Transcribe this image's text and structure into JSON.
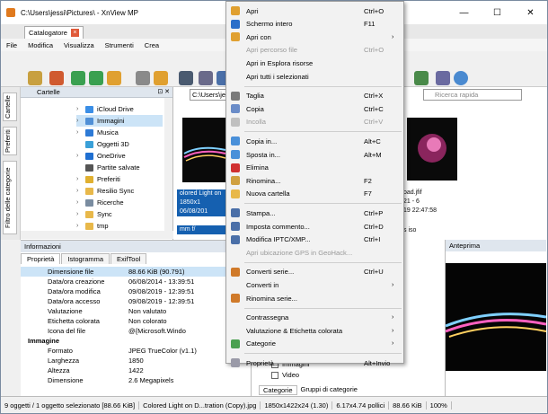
{
  "window": {
    "title": "C:\\Users\\jessi\\Pictures\\ - XnView MP",
    "min": "—",
    "max": "☐",
    "close": "✕"
  },
  "tab": {
    "label": "Catalogatore",
    "close": "×"
  },
  "menubar": [
    "File",
    "Modifica",
    "Visualizza",
    "Strumenti",
    "Crea"
  ],
  "sidebar_tabs": [
    "Cartelle",
    "Preferiti",
    "Filtro delle categorie"
  ],
  "folders": {
    "title": "Cartelle",
    "items": [
      {
        "label": "iCloud Drive",
        "expandable": true,
        "color": "#3a8ee6"
      },
      {
        "label": "Immagini",
        "expandable": true,
        "color": "#4f8fd6",
        "selected": true
      },
      {
        "label": "Musica",
        "expandable": true,
        "color": "#2d7ad6"
      },
      {
        "label": "Oggetti 3D",
        "expandable": false,
        "color": "#3aa0d8"
      },
      {
        "label": "OneDrive",
        "expandable": true,
        "color": "#1f6fd1"
      },
      {
        "label": "Partite salvate",
        "expandable": false,
        "color": "#555555"
      },
      {
        "label": "Preferiti",
        "expandable": true,
        "color": "#e0b030"
      },
      {
        "label": "Resilio Sync",
        "expandable": true,
        "color": "#e8b84a"
      },
      {
        "label": "Ricerche",
        "expandable": true,
        "color": "#7a8ca0"
      },
      {
        "label": "Sync",
        "expandable": true,
        "color": "#e8b84a"
      },
      {
        "label": "tmp",
        "expandable": true,
        "color": "#e8b84a"
      }
    ]
  },
  "browser": {
    "address": "C:\\Users\\je",
    "search_placeholder": "Ricerca rapida",
    "thumb1_lines": [
      "olored Light on",
      "1850x1",
      "06/08/201",
      "mm f/"
    ],
    "thumb2_lines": [
      "oad.jfif",
      "21 - 6",
      "19 22:47:58",
      "s iso"
    ]
  },
  "info": {
    "title": "Informazioni",
    "tabs": [
      "Proprietà",
      "Istogramma",
      "ExifTool"
    ],
    "rows": [
      {
        "k": "Dimensione file",
        "v": "88.66 KiB (90.791)",
        "sel": true
      },
      {
        "k": "Data/ora creazione",
        "v": "06/08/2014 - 13:39:51"
      },
      {
        "k": "Data/ora modifica",
        "v": "09/08/2019 - 12:39:51"
      },
      {
        "k": "Data/ora accesso",
        "v": "09/08/2019 - 12:39:51"
      },
      {
        "k": "Valutazione",
        "v": "Non valutato"
      },
      {
        "k": "Etichetta colorata",
        "v": "Non colorato"
      },
      {
        "k": "Icona del file",
        "v": "@{Microsoft.Windo"
      },
      {
        "k": "Immagine",
        "v": "",
        "group": true
      },
      {
        "k": "Formato",
        "v": "JPEG TrueColor (v1.1)"
      },
      {
        "k": "Larghezza",
        "v": "1850"
      },
      {
        "k": "Altezza",
        "v": "1422"
      },
      {
        "k": "Dimensione",
        "v": "2.6 Megapixels"
      }
    ]
  },
  "categories": {
    "items": [
      "Immagini",
      "Video"
    ],
    "tabs": [
      "Categorie",
      "Gruppi di categorie"
    ]
  },
  "preview": {
    "title": "Anteprima"
  },
  "status": [
    "9 oggetti / 1 oggetto selezionato [88.66 KiB]",
    "Colored Light on D...tration (Copy).jpg",
    "1850x1422x24 (1.30)",
    "6.17x4.74 pollici",
    "88.66 KiB",
    "100%"
  ],
  "context_menu": [
    {
      "label": "Apri",
      "shortcut": "Ctrl+O",
      "color": "#e0a030"
    },
    {
      "label": "Schermo intero",
      "shortcut": "F11",
      "color": "#2a6fc9"
    },
    {
      "label": "Apri con",
      "submenu": true,
      "color": "#e0a030"
    },
    {
      "label": "Apri percorso file",
      "shortcut": "Ctrl+O",
      "disabled": true
    },
    {
      "label": "Apri in Esplora risorse"
    },
    {
      "label": "Apri tutti i selezionati"
    },
    {
      "sep": true
    },
    {
      "label": "Taglia",
      "shortcut": "Ctrl+X",
      "color": "#7a7a7a"
    },
    {
      "label": "Copia",
      "shortcut": "Ctrl+C",
      "color": "#6a8cc8"
    },
    {
      "label": "Incolla",
      "shortcut": "Ctrl+V",
      "disabled": true,
      "color": "#c0c0c0"
    },
    {
      "sep": true
    },
    {
      "label": "Copia in...",
      "shortcut": "Alt+C",
      "color": "#4a90d9"
    },
    {
      "label": "Sposta in...",
      "shortcut": "Alt+M",
      "color": "#4a90d9"
    },
    {
      "label": "Elimina",
      "color": "#d03030"
    },
    {
      "label": "Rinomina...",
      "shortcut": "F2",
      "color": "#d0a040"
    },
    {
      "label": "Nuova cartella",
      "shortcut": "F7",
      "color": "#e8b84a"
    },
    {
      "sep": true
    },
    {
      "label": "Stampa...",
      "shortcut": "Ctrl+P",
      "color": "#4a6fa8"
    },
    {
      "label": "Imposta commento...",
      "shortcut": "Ctrl+D",
      "color": "#4a6fa8"
    },
    {
      "label": "Modifica IPTC/XMP...",
      "shortcut": "Ctrl+I",
      "color": "#4a6fa8"
    },
    {
      "label": "Apri ubicazione GPS in GeoHack...",
      "disabled": true
    },
    {
      "sep": true
    },
    {
      "label": "Converti serie...",
      "shortcut": "Ctrl+U",
      "color": "#d07a2a"
    },
    {
      "label": "Converti in",
      "submenu": true
    },
    {
      "label": "Rinomina serie...",
      "color": "#d07a2a"
    },
    {
      "sep": true
    },
    {
      "label": "Contrassegna",
      "submenu": true
    },
    {
      "label": "Valutazione & Etichetta colorata",
      "submenu": true
    },
    {
      "label": "Categorie",
      "submenu": true,
      "color": "#4aa050"
    },
    {
      "sep": true
    },
    {
      "label": "Proprietà...",
      "shortcut": "Alt+Invio",
      "color": "#9a9aa8"
    }
  ]
}
